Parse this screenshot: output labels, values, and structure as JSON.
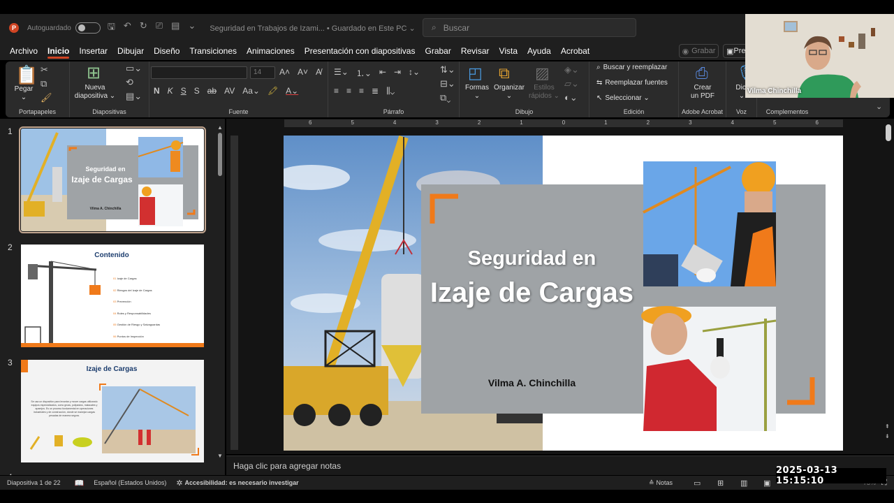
{
  "titlebar": {
    "autosave_label": "Autoguardado",
    "doc_title": "Seguridad en Trabajos de Izami...  •  Guardado en Este PC ⌄",
    "search_placeholder": "Buscar"
  },
  "menu": {
    "items": [
      "Archivo",
      "Inicio",
      "Insertar",
      "Dibujar",
      "Diseño",
      "Transiciones",
      "Animaciones",
      "Presentación con diapositivas",
      "Grabar",
      "Revisar",
      "Vista",
      "Ayuda",
      "Acrobat"
    ],
    "active": "Inicio",
    "grabar_button": "Grabar",
    "present_button": "Pre"
  },
  "ribbon": {
    "groups": {
      "clipboard": "Portapapeles",
      "slides": "Diapositivas",
      "font": "Fuente",
      "paragraph": "Párrafo",
      "drawing": "Dibujo",
      "editing": "Edición",
      "adobe": "Adobe Acrobat",
      "voice": "Voz",
      "addins": "Complementos"
    },
    "paste_label": "Pegar",
    "new_slide_line1": "Nueva",
    "new_slide_line2": "diapositiva ⌄",
    "font_size": "14",
    "shapes_label": "Formas",
    "arrange_label": "Organizar",
    "styles_line1": "Estilos",
    "styles_line2": "rápidos ⌄",
    "find_replace": "Buscar y reemplazar",
    "replace_fonts": "Reemplazar fuentes",
    "select": "Seleccionar ⌄",
    "create_pdf_line1": "Crear",
    "create_pdf_line2": "un PDF",
    "dictate": "Dict"
  },
  "webcam": {
    "name": "Vilma Chinchilla"
  },
  "thumbnails": {
    "slide1": {
      "number": "1",
      "title_line1": "Seguridad en",
      "title_line2": "Izaje de Cargas",
      "author": "Vilma A. Chinchilla"
    },
    "slide2": {
      "number": "2",
      "title": "Contenido",
      "items": [
        {
          "num": "01",
          "text": "Izaje de Cargas"
        },
        {
          "num": "02",
          "text": "Riesgos del Izaje de Cargas"
        },
        {
          "num": "03",
          "text": "Prevención"
        },
        {
          "num": "04",
          "text": "Roles y Responsabilidades"
        },
        {
          "num": "05",
          "text": "Gestión de Riesgo y Salvaguardas"
        },
        {
          "num": "06",
          "text": "Puntos de Inspección"
        }
      ]
    },
    "slide3": {
      "number": "3",
      "title": "Izaje de Cargas",
      "body": "Se usa un dispositivo para levantar y mover cargas utilizando equipos especializados, como grúas, polipastos, malacates y aparejos. Es un proceso fundamental en operaciones industriales y de construcción, donde se manejan cargas pesadas de manera segura."
    },
    "slide4_number": "4"
  },
  "ruler": {
    "labels": [
      "6",
      "5",
      "4",
      "3",
      "2",
      "1",
      "0",
      "1",
      "2",
      "3",
      "4",
      "5",
      "6"
    ]
  },
  "slide": {
    "title_line1": "Seguridad en",
    "title_line2": "Izaje de Cargas",
    "author": "Vilma A. Chinchilla",
    "accent_color": "#f07a1a",
    "panel_color": "#9fa3a6"
  },
  "notes_placeholder": "Haga clic para agregar notas",
  "status": {
    "slide_counter": "Diapositiva 1 de 22",
    "language": "Español (Estados Unidos)",
    "accessibility": "Accesibilidad: es necesario investigar",
    "notes_button": "Notas",
    "zoom": "73%"
  },
  "timestamp": "2025-03-13  15:15:10"
}
